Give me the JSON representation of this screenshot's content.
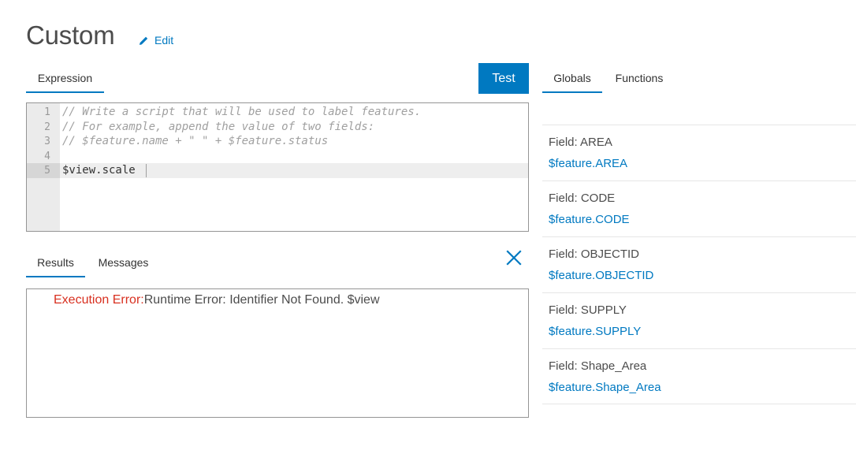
{
  "header": {
    "title": "Custom",
    "edit_label": "Edit",
    "edit_icon": "pencil-icon"
  },
  "editor": {
    "tab_label": "Expression",
    "test_label": "Test",
    "lines": [
      {
        "num": "1",
        "text": "// Write a script that will be used to label features.",
        "kind": "comment"
      },
      {
        "num": "2",
        "text": "// For example, append the value of two fields:",
        "kind": "comment"
      },
      {
        "num": "3",
        "text": "// $feature.name + \" \" + $feature.status",
        "kind": "comment"
      },
      {
        "num": "4",
        "text": "",
        "kind": "code"
      },
      {
        "num": "5",
        "text": "$view.scale ",
        "kind": "code"
      }
    ]
  },
  "results": {
    "tabs": [
      "Results",
      "Messages"
    ],
    "error_label": "Execution Error:",
    "error_message": "Runtime Error: Identifier Not Found. $view",
    "close_icon": "close-icon"
  },
  "sidebar": {
    "tabs": [
      "Globals",
      "Functions"
    ],
    "items": [
      {
        "label": "Field: AREA",
        "value": "$feature.AREA"
      },
      {
        "label": "Field: CODE",
        "value": "$feature.CODE"
      },
      {
        "label": "Field: OBJECTID",
        "value": "$feature.OBJECTID"
      },
      {
        "label": "Field: SUPPLY",
        "value": "$feature.SUPPLY"
      },
      {
        "label": "Field: Shape_Area",
        "value": "$feature.Shape_Area"
      }
    ]
  },
  "colors": {
    "accent": "#0079c1",
    "error": "#d83020"
  }
}
